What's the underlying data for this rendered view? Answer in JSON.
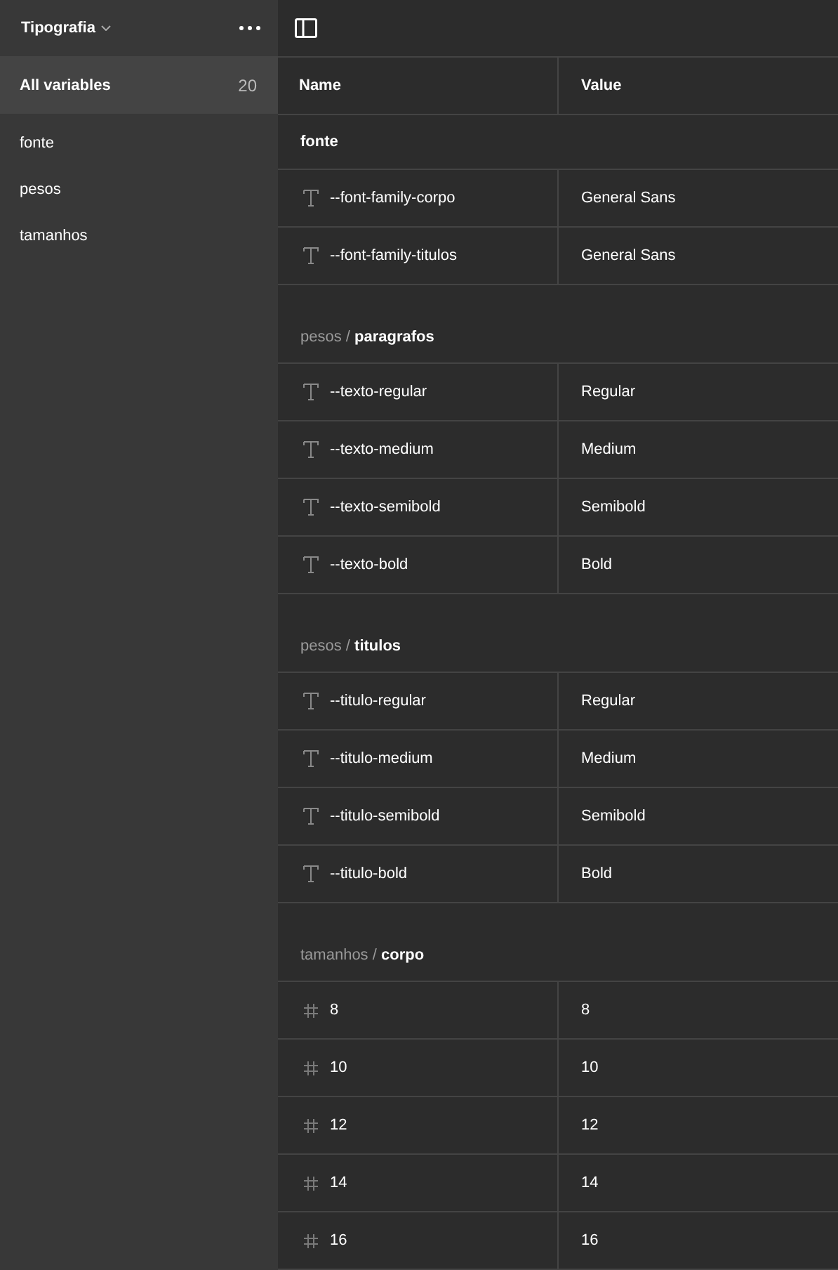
{
  "sidebar": {
    "collection": "Tipografia",
    "items": [
      {
        "label": "All variables",
        "count": "20",
        "selected": true
      },
      {
        "label": "fonte",
        "selected": false
      },
      {
        "label": "pesos",
        "selected": false
      },
      {
        "label": "tamanhos",
        "selected": false
      }
    ]
  },
  "table": {
    "columns": [
      "Name",
      "Value"
    ],
    "groups": [
      {
        "name": "fonte",
        "variables": [
          {
            "kind": "string",
            "name": "--font-family-corpo",
            "value": "General Sans"
          },
          {
            "kind": "string",
            "name": "--font-family-titulos",
            "value": "General Sans"
          }
        ]
      },
      {
        "title": "pesos / **paragrafos**",
        "variables": [
          {
            "kind": "string",
            "name": "--texto-regular",
            "value": "Regular"
          },
          {
            "kind": "string",
            "name": "--texto-medium",
            "value": "Medium"
          },
          {
            "kind": "string",
            "name": "--texto-semibold",
            "value": "Semibold"
          },
          {
            "kind": "string",
            "name": "--texto-bold",
            "value": "Bold"
          }
        ]
      },
      {
        "title": "pesos / **titulos**",
        "variables": [
          {
            "kind": "string",
            "name": "--titulo-regular",
            "value": "Regular"
          },
          {
            "kind": "string",
            "name": "--titulo-medium",
            "value": "Medium"
          },
          {
            "kind": "string",
            "name": "--titulo-semibold",
            "value": "Semibold"
          },
          {
            "kind": "string",
            "name": "--titulo-bold",
            "value": "Bold"
          }
        ]
      },
      {
        "title": "tamanhos / **corpo**",
        "variables": [
          {
            "kind": "number",
            "name": "8",
            "value": "8"
          },
          {
            "kind": "number",
            "name": "10",
            "value": "10"
          },
          {
            "kind": "number",
            "name": "12",
            "value": "12"
          },
          {
            "kind": "number",
            "name": "14",
            "value": "14"
          },
          {
            "kind": "number",
            "name": "16",
            "value": "16"
          }
        ]
      }
    ]
  }
}
